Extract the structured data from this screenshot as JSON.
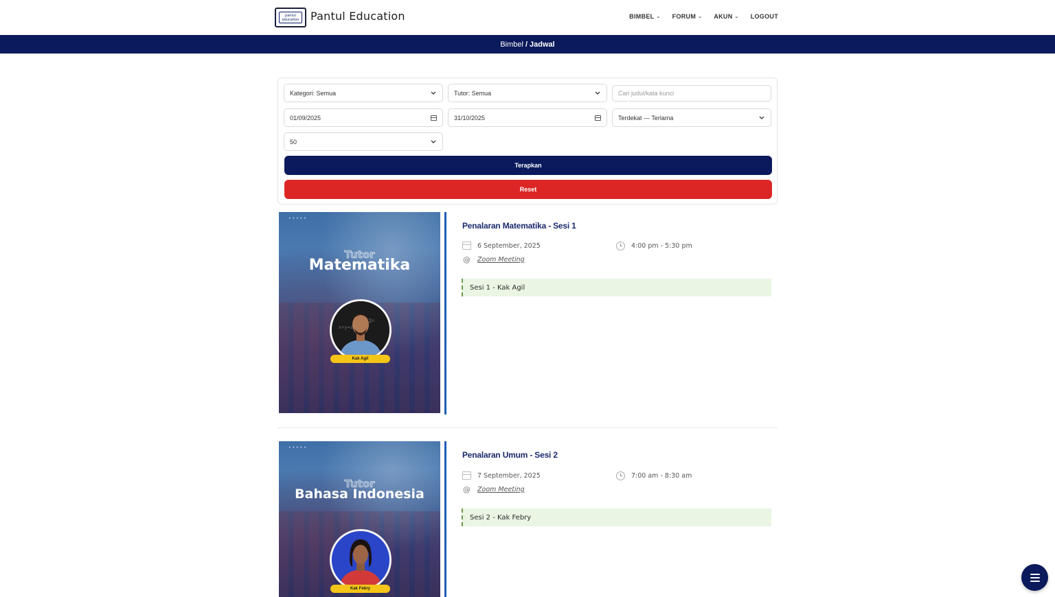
{
  "brand": {
    "logo_line1": "pantul",
    "logo_line2": "education",
    "name": "Pantul Education"
  },
  "nav": {
    "items": [
      "BIMBEL",
      "FORUM",
      "AKUN"
    ],
    "logout": "LOGOUT"
  },
  "breadcrumb": {
    "parent": "Bimbel",
    "separator": "/",
    "current": "Jadwal"
  },
  "filters": {
    "kategori": "Kategori: Semua",
    "tutor": "Tutor: Semua",
    "search_placeholder": "Cari judul/kata kunci",
    "date_from": "01/09/2025",
    "date_to": "31/10/2025",
    "sort": "Terdekat — Terlama",
    "per_page": "50",
    "apply_label": "Terapkan",
    "reset_label": "Reset"
  },
  "events": [
    {
      "poster_tutor_word": "Tutor",
      "poster_subject": "Matematika",
      "poster_name": "Kak Agil",
      "title": "Penalaran Matematika - Sesi 1",
      "date": "6 September, 2025",
      "time": "4:00 pm - 5:30 pm",
      "location": "Zoom Meeting",
      "session": "Sesi 1 - Kak Agil"
    },
    {
      "poster_tutor_word": "Tutor",
      "poster_subject": "Bahasa Indonesia",
      "poster_name": "Kak Febry",
      "title": "Penalaran Umum - Sesi 2",
      "date": "7 September, 2025",
      "time": "7:00 am - 8:30 am",
      "location": "Zoom Meeting",
      "session": "Sesi 2 - Kak Febry"
    }
  ],
  "colors": {
    "navy": "#0a1a5c",
    "red": "#dc2626",
    "accent_line": "#1f5db6",
    "session_bg": "#eaf5e4",
    "pill": "#f5c518"
  }
}
